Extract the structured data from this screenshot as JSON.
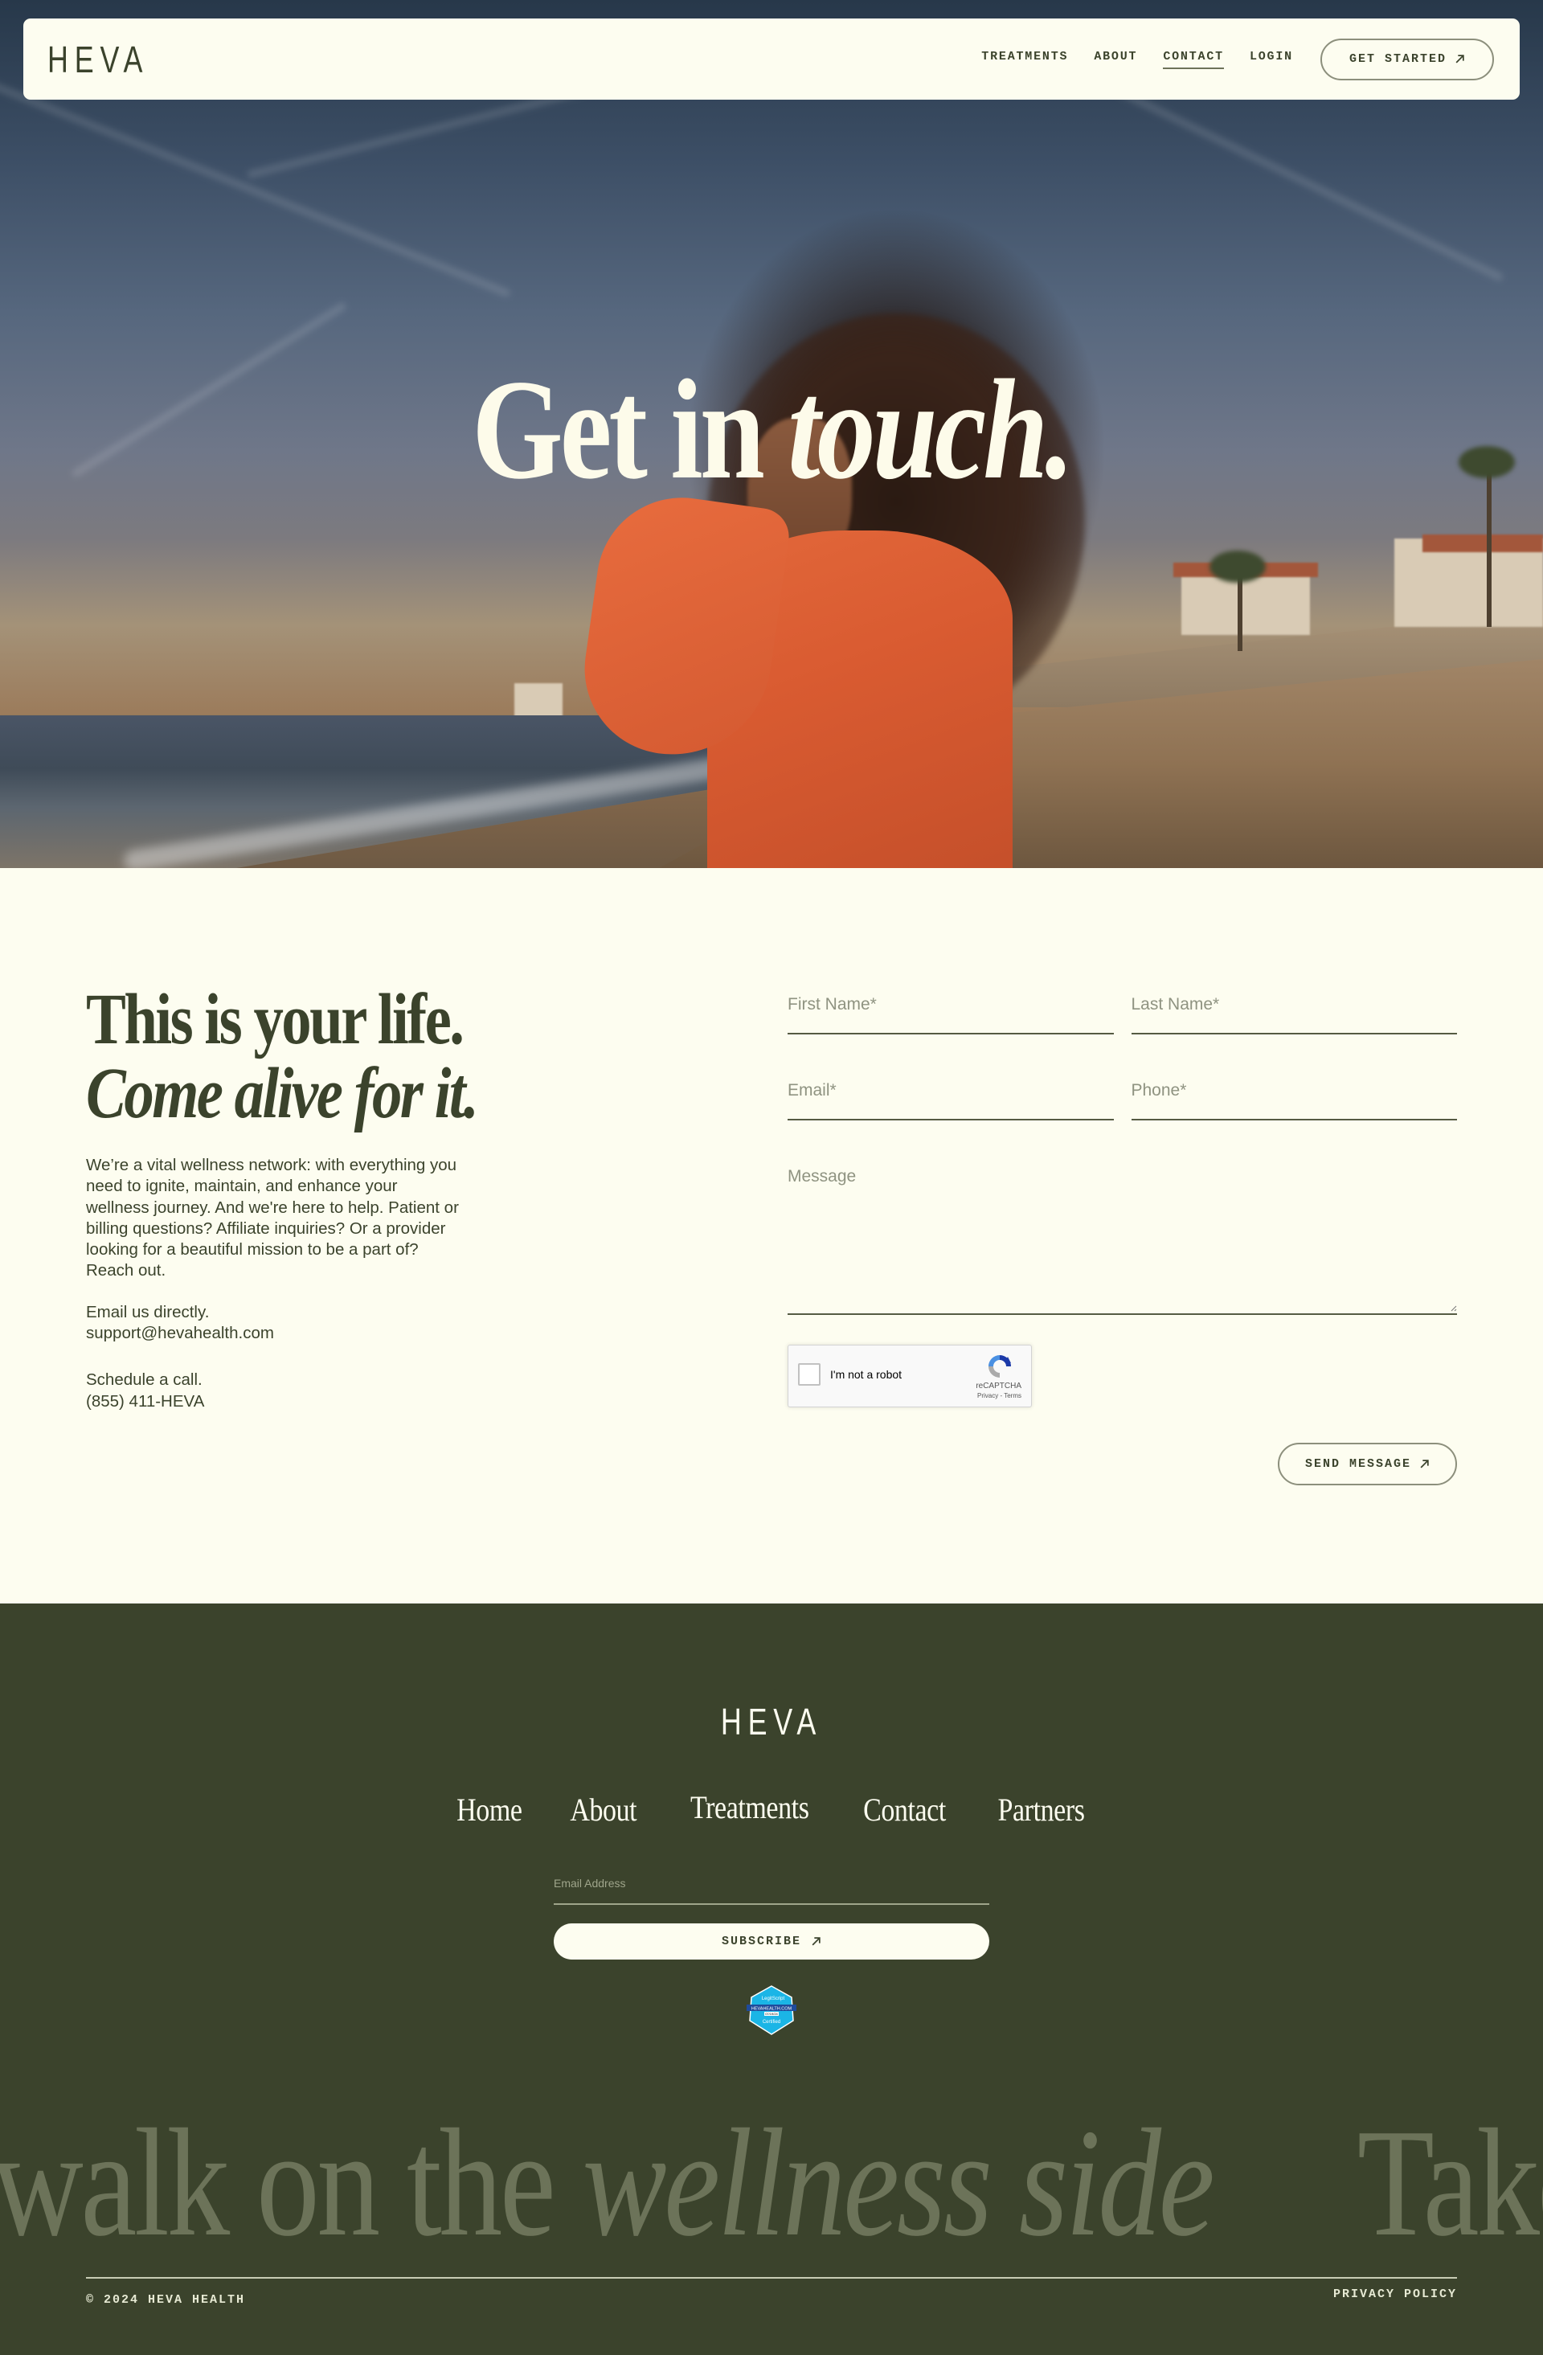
{
  "brand": {
    "logo": "HEVA"
  },
  "nav": {
    "links": [
      {
        "label": "TREATMENTS",
        "active": false
      },
      {
        "label": "ABOUT",
        "active": false
      },
      {
        "label": "CONTACT",
        "active": true
      },
      {
        "label": "LOGIN",
        "active": false
      }
    ],
    "cta_label": "GET STARTED",
    "cta_icon": "arrow-up-right-icon"
  },
  "hero": {
    "title_regular": "Get in",
    "title_italic": "touch."
  },
  "contact": {
    "headline_regular": "This is your life.",
    "headline_italic": "Come alive for it.",
    "body": "We’re a vital wellness network: with everything you need to ignite, maintain, and enhance your wellness journey. And we're here to help. Patient or billing questions? Affiliate inquiries? Or a provider looking for a beautiful mission to be a part of? Reach out.",
    "email_label": "Email us directly.",
    "email_value": "support@hevahealth.com",
    "phone_label": "Schedule a call.",
    "phone_value": "(855) 411-HEVA"
  },
  "form": {
    "first_name": {
      "placeholder": "First Name*",
      "value": ""
    },
    "last_name": {
      "placeholder": "Last Name*",
      "value": ""
    },
    "email": {
      "placeholder": "Email*",
      "value": ""
    },
    "phone": {
      "placeholder": "Phone*",
      "value": ""
    },
    "message": {
      "placeholder": "Message",
      "value": ""
    },
    "recaptcha": {
      "label": "I'm not a robot",
      "brand": "reCAPTCHA",
      "links": "Privacy - Terms",
      "checked": false
    },
    "submit_label": "SEND MESSAGE"
  },
  "footer": {
    "logo": "HEVA",
    "links": [
      "Home",
      "About",
      "Treatments",
      "Contact",
      "Partners"
    ],
    "newsletter": {
      "placeholder": "Email Address",
      "value": "",
      "button_label": "SUBSCRIBE"
    },
    "badge": {
      "brand": "LegitScript",
      "domain": "HEVAHEALTH.COM",
      "date": "07/19/24",
      "status": "Certified"
    },
    "marquee": {
      "segment_1_regular": "walk on the",
      "segment_1_italic": "wellness side",
      "segment_2_regular": "Take a"
    },
    "copyright": "© 2024 HEVA HEALTH",
    "privacy_label": "PRIVACY POLICY"
  },
  "colors": {
    "cream": "#fdfdf0",
    "olive": "#3b432c",
    "olive_muted": "#6c7359",
    "placeholder": "#8f9381",
    "hero_orange": "#d95b31",
    "badge_blue": "#1bb5e6"
  }
}
